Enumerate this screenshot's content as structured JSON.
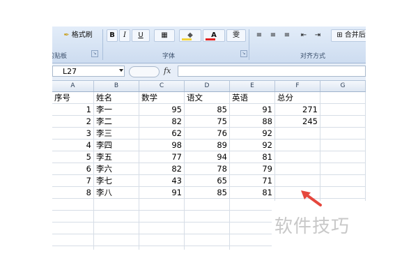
{
  "ribbon": {
    "format_painter_label": "格式刷",
    "clipboard_label": "剪贴板",
    "bold_label": "B",
    "italic_label": "I",
    "underline_label": "U",
    "font_color_glyph": "A",
    "phonetic_glyph": "雯",
    "font_group_label": "字体",
    "merge_label": "合并后",
    "alignment_group_label": "对齐方式"
  },
  "formula_bar": {
    "name_box": "L27",
    "fx_label": "fx",
    "formula": ""
  },
  "columns": [
    "A",
    "B",
    "C",
    "D",
    "E",
    "F",
    "G"
  ],
  "rows": [
    [
      "序号",
      "姓名",
      "数学",
      "语文",
      "英语",
      "总分",
      ""
    ],
    [
      "1",
      "李一",
      "95",
      "85",
      "91",
      "271",
      ""
    ],
    [
      "2",
      "李二",
      "82",
      "75",
      "88",
      "245",
      ""
    ],
    [
      "3",
      "李三",
      "62",
      "76",
      "92",
      "",
      ""
    ],
    [
      "4",
      "李四",
      "98",
      "89",
      "92",
      "",
      ""
    ],
    [
      "5",
      "李五",
      "77",
      "94",
      "81",
      "",
      ""
    ],
    [
      "6",
      "李六",
      "82",
      "78",
      "79",
      "",
      ""
    ],
    [
      "7",
      "李七",
      "43",
      "65",
      "71",
      "",
      ""
    ],
    [
      "8",
      "李八",
      "91",
      "85",
      "81",
      "",
      ""
    ],
    [
      "",
      "",
      "",
      "",
      "",
      "",
      ""
    ],
    [
      "",
      "",
      "",
      "",
      "",
      "",
      ""
    ],
    [
      "",
      "",
      "",
      "",
      "",
      "",
      ""
    ],
    [
      "",
      "",
      "",
      "",
      "",
      "",
      ""
    ],
    [
      "",
      "",
      "",
      "",
      "",
      "",
      ""
    ],
    [
      "",
      "",
      "",
      "",
      "",
      "",
      ""
    ]
  ],
  "watermark": "软件技巧",
  "colors": {
    "accent_arrow": "#e5473d",
    "font_color_bar": "#e02020",
    "fill_color_bar": "#f2d33a"
  }
}
